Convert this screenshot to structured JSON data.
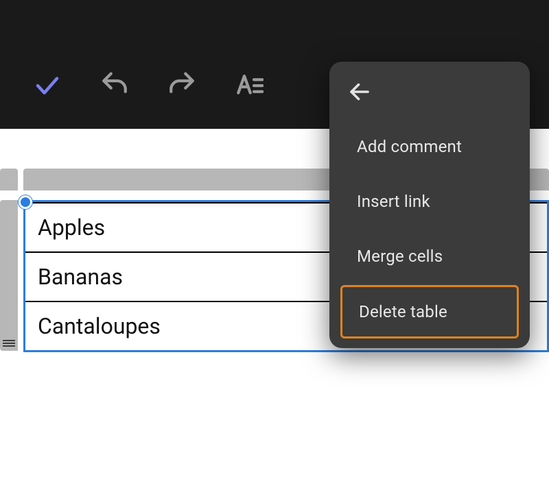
{
  "toolbar": {
    "icons": [
      "check",
      "undo",
      "redo",
      "text-format"
    ]
  },
  "table": {
    "rows": [
      "Apples",
      "Bananas",
      "Cantaloupes"
    ]
  },
  "context_menu": {
    "items": [
      {
        "label": "Add comment",
        "highlight": false
      },
      {
        "label": "Insert link",
        "highlight": false
      },
      {
        "label": "Merge cells",
        "highlight": false
      },
      {
        "label": "Delete table",
        "highlight": true
      }
    ]
  },
  "colors": {
    "selection": "#2a7de1",
    "menu_bg": "#3b3b3b",
    "highlight_border": "#e0821e",
    "toolbar_bg": "#1a1a1a",
    "accent_icon": "#7a80ef"
  }
}
